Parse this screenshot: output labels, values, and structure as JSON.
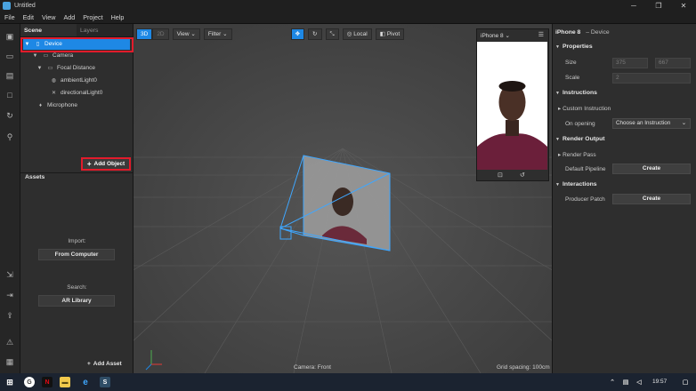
{
  "window": {
    "title": "Untitled"
  },
  "menu": [
    "File",
    "Edit",
    "View",
    "Add",
    "Project",
    "Help"
  ],
  "scene": {
    "tabs": [
      "Scene",
      "Layers"
    ],
    "tree": [
      {
        "label": "Device",
        "icon": "device-icon"
      },
      {
        "label": "Camera",
        "icon": "camera-icon"
      },
      {
        "label": "Focal Distance",
        "icon": "focal-distance-icon"
      },
      {
        "label": "ambientLight0",
        "icon": "ambient-light-icon"
      },
      {
        "label": "directionalLight0",
        "icon": "directional-light-icon"
      },
      {
        "label": "Microphone",
        "icon": "microphone-icon"
      }
    ],
    "add_object": "Add Object"
  },
  "assets": {
    "title": "Assets",
    "import_label": "Import:",
    "from_computer": "From Computer",
    "search_label": "Search:",
    "ar_library": "AR Library",
    "add_asset": "Add Asset"
  },
  "viewport": {
    "mode_3d": "3D",
    "mode_2d": "2D",
    "view_menu": "View",
    "filter_menu": "Filter",
    "local": "Local",
    "pivot": "Pivot",
    "camera_label": "Camera: Front",
    "grid_label": "Grid spacing: 100cm",
    "device_select": "iPhone 8"
  },
  "inspector": {
    "title": "iPhone 8",
    "subtitle": "– Device",
    "properties": "Properties",
    "size_label": "Size",
    "size_w": "375",
    "size_h": "667",
    "scale_label": "Scale",
    "scale_value": "2",
    "instructions": "Instructions",
    "custom_instruction": "Custom Instruction",
    "on_opening": "On opening",
    "choose_instruction": "Choose an Instruction",
    "render_output": "Render Output",
    "render_pass": "Render Pass",
    "default_pipeline": "Default Pipeline",
    "create": "Create",
    "interactions": "Interactions",
    "producer_patch": "Producer Patch"
  },
  "taskbar": {
    "clock": "19:57"
  },
  "colors": {
    "accent": "#1e88e5",
    "highlight_red": "#e21b2b"
  }
}
